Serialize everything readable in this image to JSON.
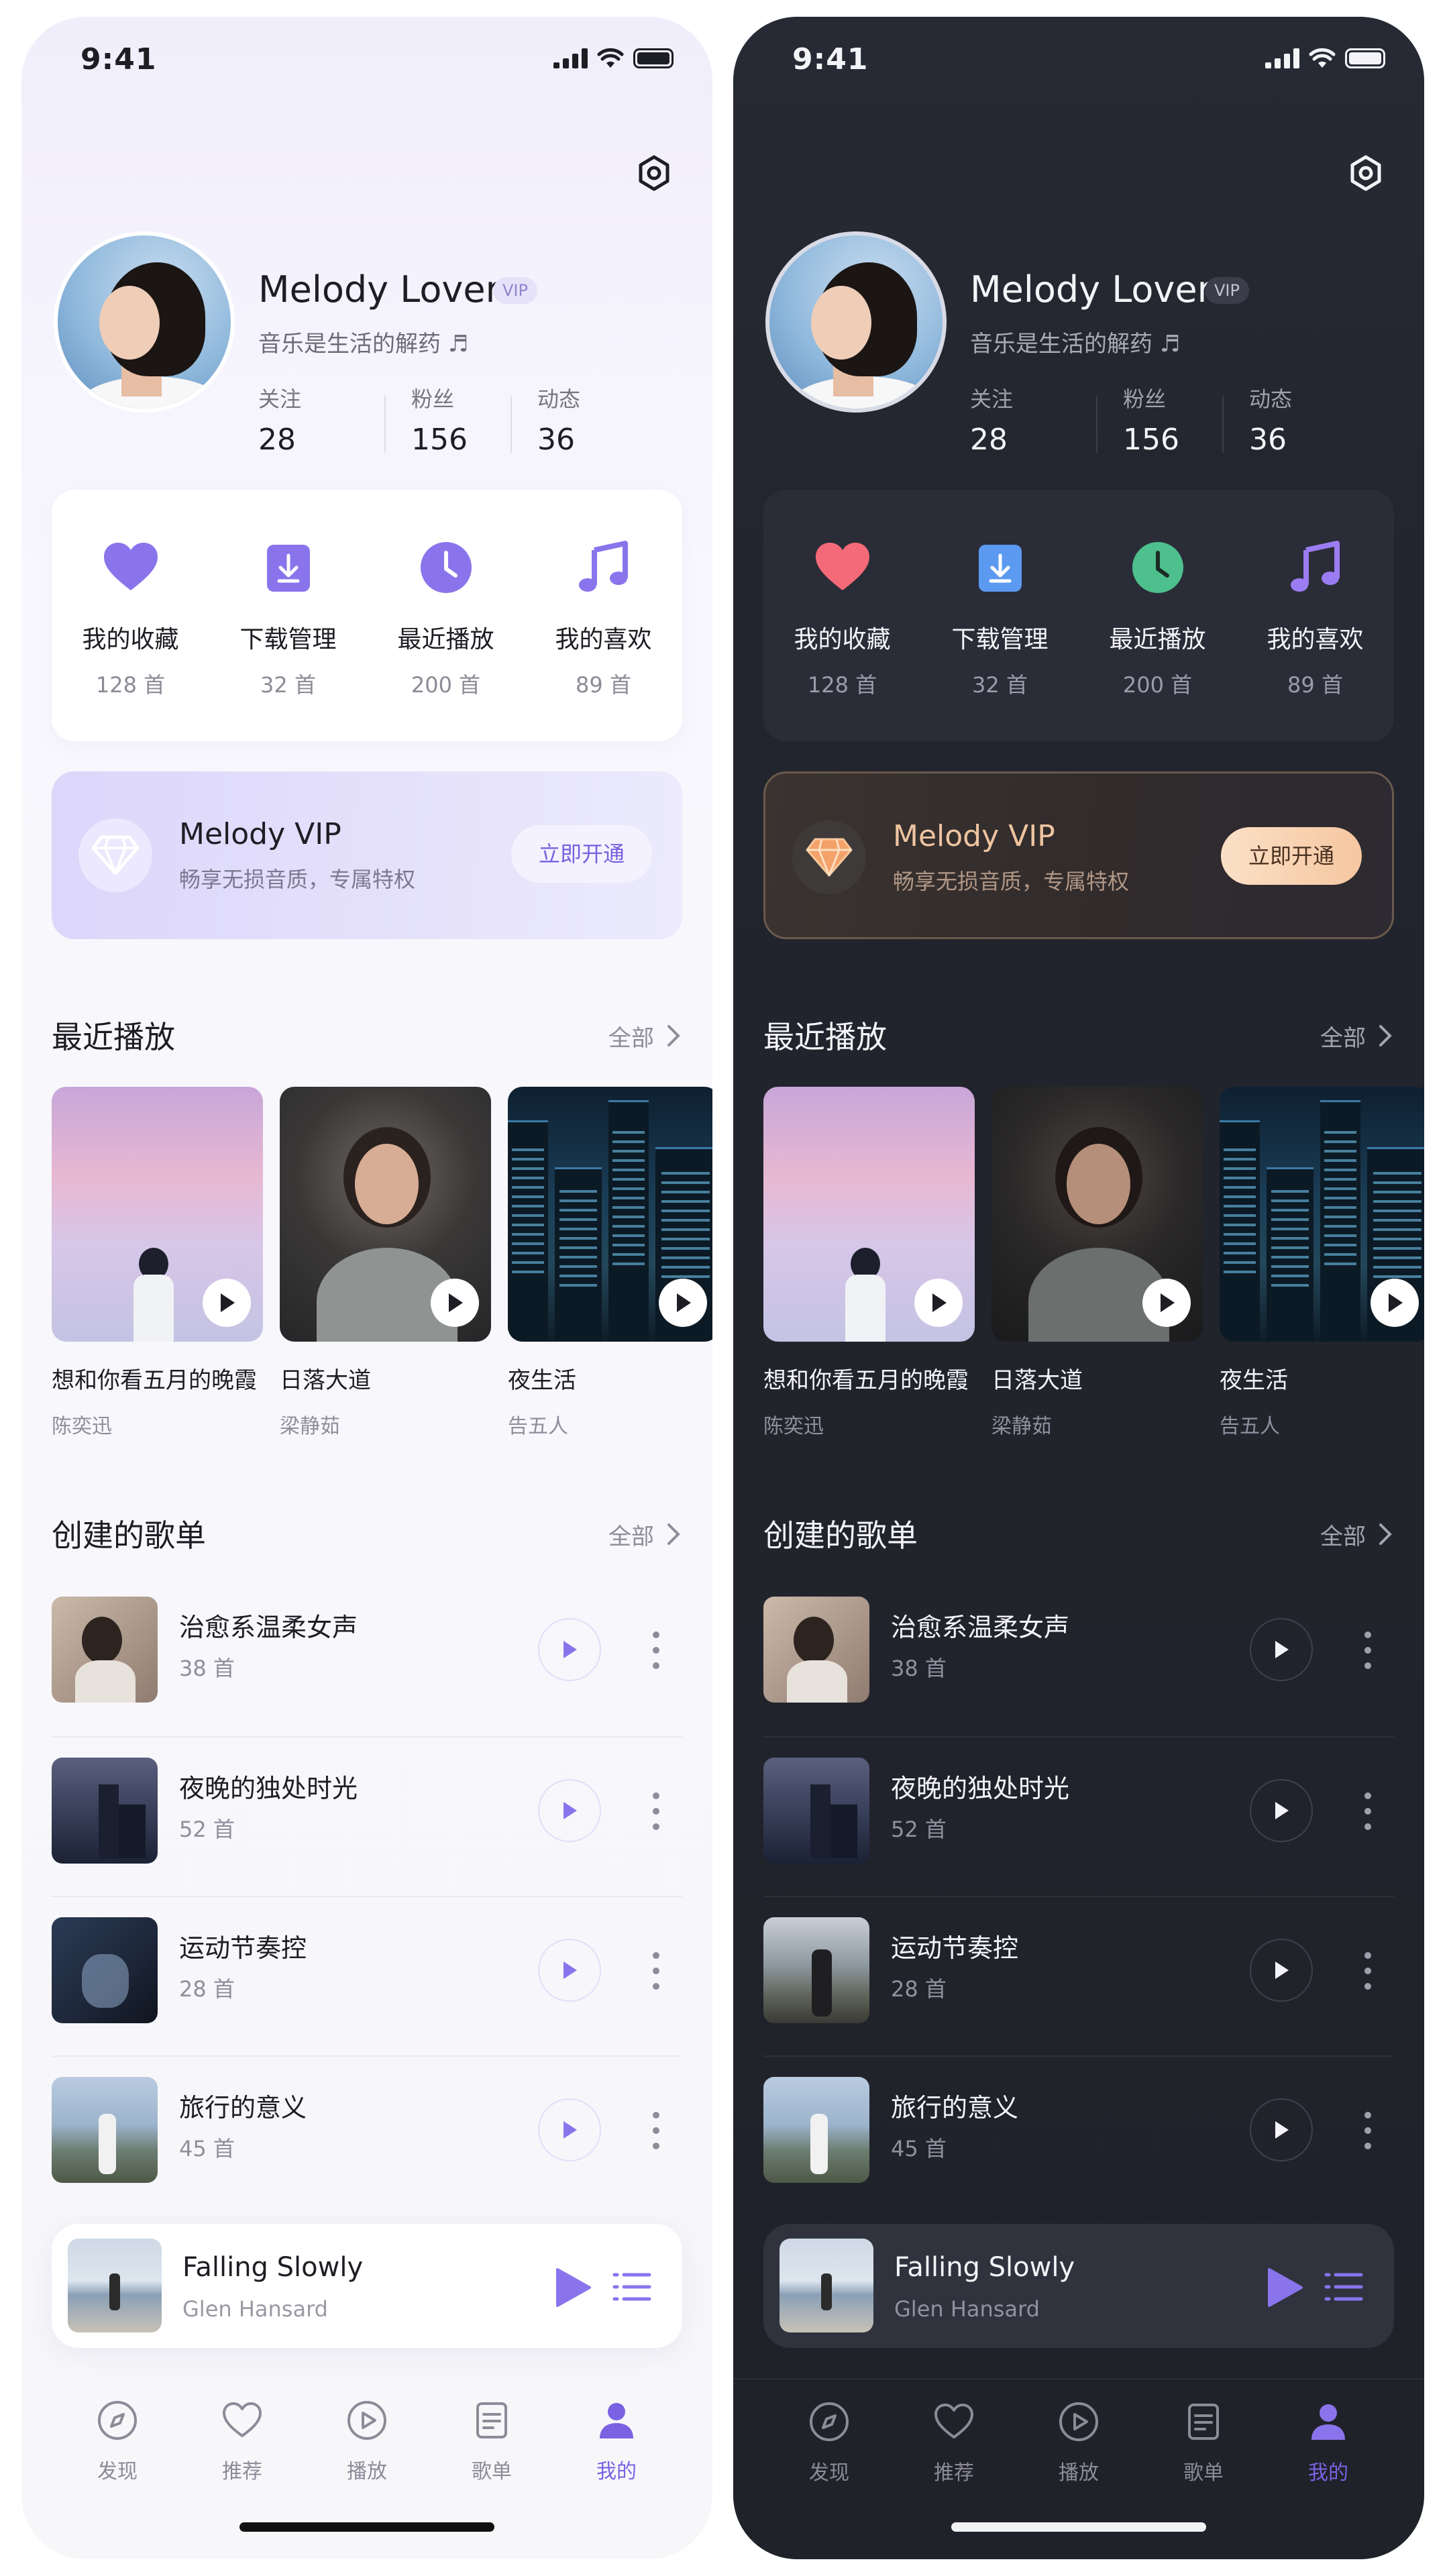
{
  "status": {
    "time": "9:41"
  },
  "profile": {
    "name": "Melody Lover",
    "vip_tag": "VIP",
    "bio": "音乐是生活的解药 ♬",
    "stats": [
      {
        "label": "关注",
        "value": "28"
      },
      {
        "label": "粉丝",
        "value": "156"
      },
      {
        "label": "动态",
        "value": "36"
      }
    ]
  },
  "quick": [
    {
      "label": "我的收藏",
      "count": "128 首",
      "icon": "heart-icon"
    },
    {
      "label": "下载管理",
      "count": "32 首",
      "icon": "download-icon"
    },
    {
      "label": "最近播放",
      "count": "200 首",
      "icon": "clock-icon"
    },
    {
      "label": "我的喜欢",
      "count": "89 首",
      "icon": "music-note-icon"
    }
  ],
  "vip": {
    "title": "Melody VIP",
    "subtitle": "畅享无损音质，专属特权",
    "button": "立即开通"
  },
  "recent": {
    "title": "最近播放",
    "all": "全部",
    "items": [
      {
        "title": "想和你看五月的晚霞",
        "artist": "陈奕迅"
      },
      {
        "title": "日落大道",
        "artist": "梁静茹"
      },
      {
        "title": "夜生活",
        "artist": "告五人"
      }
    ]
  },
  "playlists": {
    "title": "创建的歌单",
    "all": "全部",
    "items": [
      {
        "name": "治愈系温柔女声",
        "count": "38 首"
      },
      {
        "name": "夜晚的独处时光",
        "count": "52 首"
      },
      {
        "name": "运动节奏控",
        "count": "28 首"
      },
      {
        "name": "旅行的意义",
        "count": "45 首"
      }
    ]
  },
  "now_playing": {
    "title": "Falling Slowly",
    "artist": "Glen Hansard"
  },
  "tabs": [
    {
      "label": "发现",
      "icon": "compass-icon"
    },
    {
      "label": "推荐",
      "icon": "heart-outline-icon"
    },
    {
      "label": "播放",
      "icon": "play-circle-icon"
    },
    {
      "label": "歌单",
      "icon": "list-doc-icon"
    },
    {
      "label": "我的",
      "icon": "user-icon",
      "active": true
    }
  ],
  "colors": {
    "accent": "#7a62e3",
    "light_background": "#f7f7fa",
    "dark_background": "#22242c",
    "dark_vip_gold": "#efc4a0",
    "dark_heart": "#f56a78",
    "dark_download": "#5b9af0",
    "dark_clock": "#4ec08d"
  }
}
